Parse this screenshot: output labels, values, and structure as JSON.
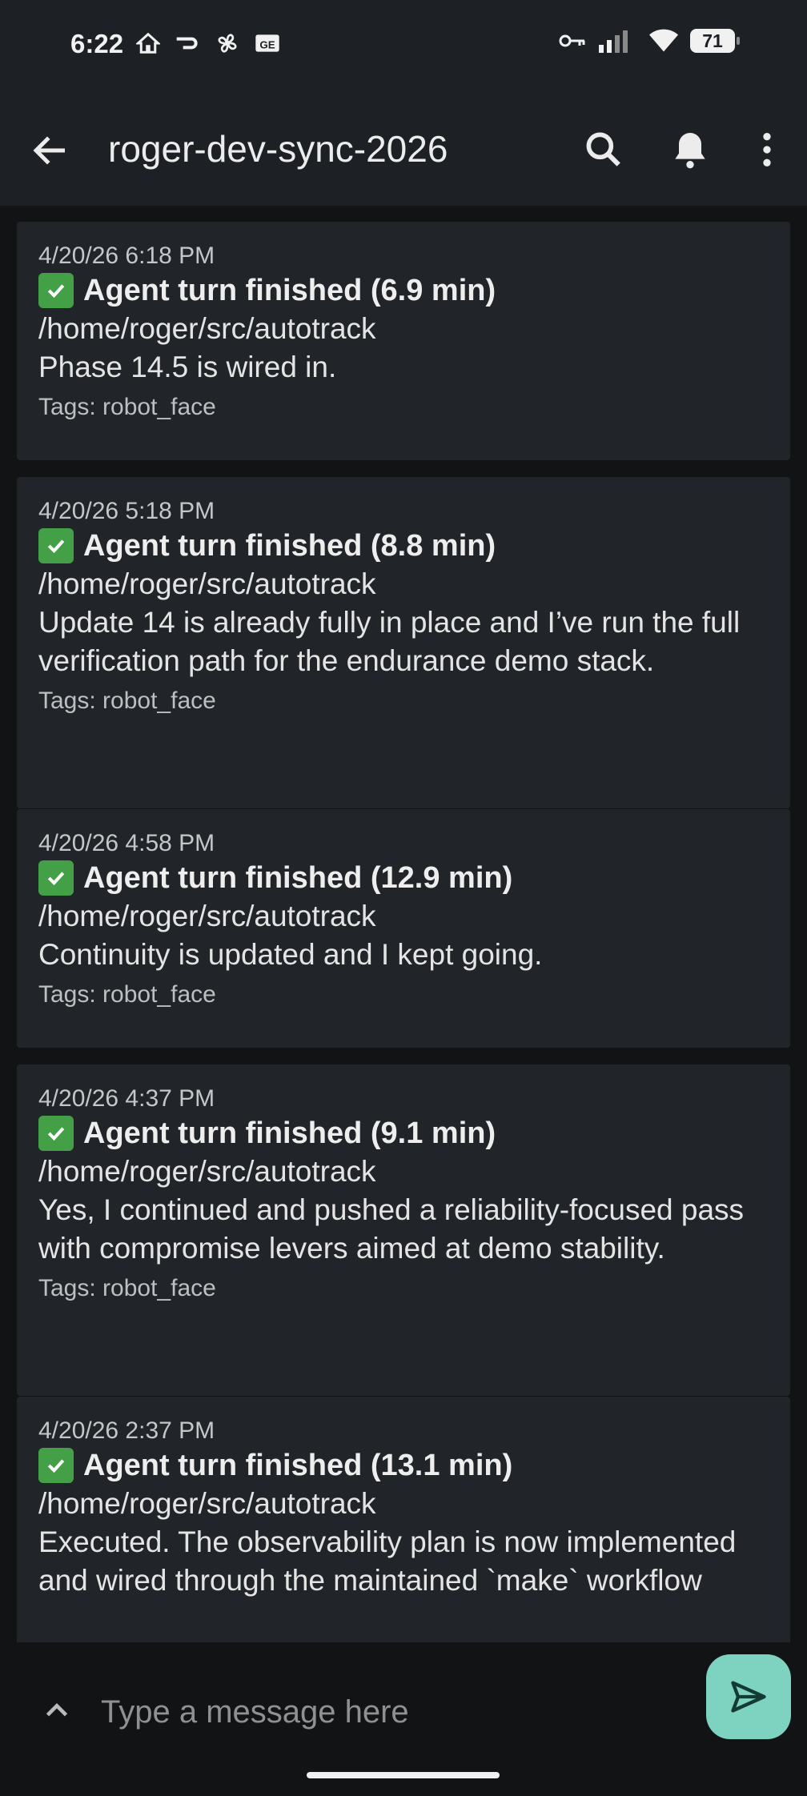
{
  "status_bar": {
    "time": "6:22",
    "battery": "71",
    "icons_left": [
      "home-icon",
      "cast-icon",
      "fan-icon",
      "caption-icon"
    ],
    "icons_right": [
      "vpn-key-icon",
      "signal-icon",
      "wifi-icon",
      "battery-icon"
    ]
  },
  "app_bar": {
    "title": "roger-dev-sync-2026",
    "actions": [
      "search-icon",
      "bell-icon",
      "more-vert-icon"
    ]
  },
  "messages": [
    {
      "timestamp": "4/20/26 6:18 PM",
      "heading": "Agent turn finished (6.9 min)",
      "path": "/home/roger/src/autotrack",
      "body": "Phase 14.5 is wired in.",
      "tags": "Tags: robot_face"
    },
    {
      "timestamp": "4/20/26 5:18 PM",
      "heading": "Agent turn finished (8.8 min)",
      "path": "/home/roger/src/autotrack",
      "body": "Update 14 is already fully in place and I’ve run the full verification path for the endurance demo stack.",
      "tags": "Tags: robot_face"
    },
    {
      "timestamp": "4/20/26 4:58 PM",
      "heading": "Agent turn finished (12.9 min)",
      "path": "/home/roger/src/autotrack",
      "body": "Continuity is updated and I kept going.",
      "tags": "Tags: robot_face"
    },
    {
      "timestamp": "4/20/26 4:37 PM",
      "heading": "Agent turn finished (9.1 min)",
      "path": "/home/roger/src/autotrack",
      "body": "Yes, I continued and pushed a reliability-focused pass with compromise levers aimed at demo stability.",
      "tags": "Tags: robot_face"
    },
    {
      "timestamp": "4/20/26 2:37 PM",
      "heading": "Agent turn finished (13.1 min)",
      "path": "/home/roger/src/autotrack",
      "body": "Executed. The observability plan is now implemented and wired through the maintained `make` workflow",
      "tags": ""
    }
  ],
  "composer": {
    "placeholder": "Type a message here",
    "send_icon": "send-icon",
    "expand_icon": "chevron-up-icon"
  },
  "colors": {
    "app_bar": "#1d2125",
    "background": "#111315",
    "card": "#212529",
    "accent": "#7dd3c0",
    "check": "#43a047"
  }
}
